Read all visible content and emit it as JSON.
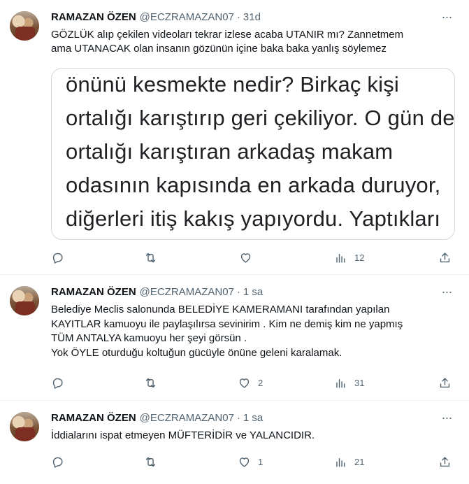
{
  "tweets": [
    {
      "name": "RAMAZAN ÖZEN",
      "handle": "@ECZRAMAZAN07",
      "separator": "·",
      "time": "31d",
      "more": "···",
      "text_lines": [
        "GÖZLÜK alıp çekilen videoları tekrar izlese acaba UTANIR mı? Zannetmem",
        "ama UTANACAK olan insanın gözünün içine baka baka yanlış söylemez"
      ],
      "media_lines": [
        "önünü kesmekte nedir? Birkaç kişi",
        "ortalığı karıştırıp geri çekiliyor. O gün de",
        "ortalığı karıştıran arkadaş makam",
        "odasının kapısında en arkada duruyor,",
        "diğerleri itiş kakış yapıyordu. Yaptıkları"
      ],
      "replies": "",
      "retweets": "",
      "likes": "",
      "views": "12"
    },
    {
      "name": "RAMAZAN ÖZEN",
      "handle": "@ECZRAMAZAN07",
      "separator": "·",
      "time": "1 sa",
      "more": "···",
      "text_lines": [
        "Belediye Meclis salonunda BELEDİYE KAMERAMANI tarafından yapılan",
        "KAYITLAR kamuoyu ile paylaşılırsa sevinirim . Kim ne demiş kim ne yapmış",
        "TÜM ANTALYA kamuoyu her şeyi görsün .",
        "Yok ÖYLE oturduğu koltuğun gücüyle önüne geleni karalamak."
      ],
      "replies": "",
      "retweets": "",
      "likes": "2",
      "views": "31"
    },
    {
      "name": "RAMAZAN ÖZEN",
      "handle": "@ECZRAMAZAN07",
      "separator": "·",
      "time": "1 sa",
      "more": "···",
      "text_lines": [
        "İddialarını ispat etmeyen MÜFTERİDİR ve YALANCIDIR."
      ],
      "replies": "",
      "retweets": "",
      "likes": "1",
      "views": "21"
    }
  ]
}
